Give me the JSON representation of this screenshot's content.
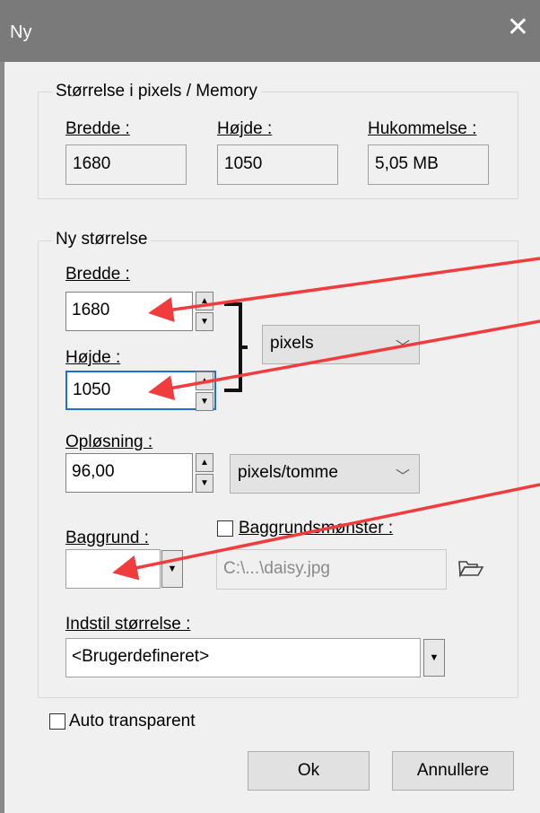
{
  "window": {
    "title": "Ny",
    "close_glyph": "✕"
  },
  "size_group": {
    "legend": "Størrelse i pixels / Memory",
    "width_label": "Bredde :",
    "width_value": "1680",
    "height_label": "Højde :",
    "height_value": "1050",
    "memory_label": "Hukommelse :",
    "memory_value": "5,05 MB"
  },
  "new_size_group": {
    "legend": "Ny størrelse",
    "width_label": "Bredde :",
    "width_value": "1680",
    "height_label": "Højde :",
    "height_value": "1050",
    "unit_selected": "pixels",
    "resolution_label": "Opløsning :",
    "resolution_value": "96,00",
    "resolution_unit": "pixels/tomme",
    "background_label": "Baggrund :",
    "pattern_label": "Baggrundsmønster :",
    "pattern_path": "C:\\...\\daisy.jpg",
    "preset_label": "Indstil størrelse :",
    "preset_value": "<Brugerdefineret>"
  },
  "auto_transparent_label": "Auto transparent",
  "buttons": {
    "ok": "Ok",
    "cancel": "Annullere"
  },
  "icons": {
    "spin_up": "▲",
    "spin_down": "▼",
    "dropdown": "▼",
    "chevron": "﹀",
    "folder": "folder-open-icon"
  },
  "colors": {
    "annotation_arrow": "#f03c3c",
    "focus_border": "#1d6ed8",
    "titlebar": "#7a7a7a"
  }
}
